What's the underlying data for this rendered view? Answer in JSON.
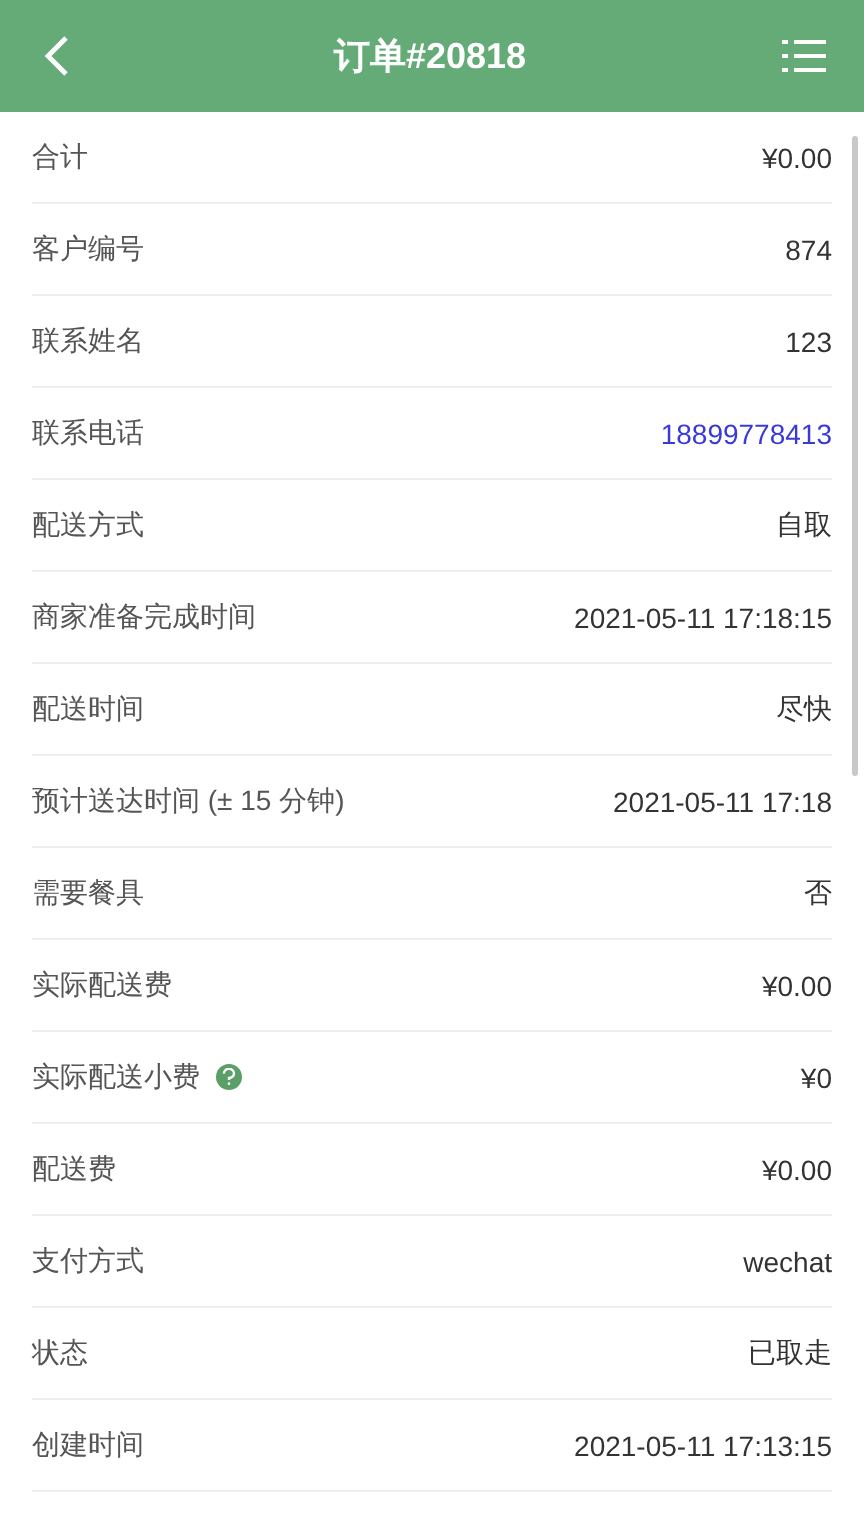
{
  "header": {
    "title": "订单#20818"
  },
  "rows": [
    {
      "label": "合计",
      "value": "¥0.00",
      "kind": "plain",
      "help": false
    },
    {
      "label": "客户编号",
      "value": "874",
      "kind": "plain",
      "help": false
    },
    {
      "label": "联系姓名",
      "value": "123",
      "kind": "plain",
      "help": false
    },
    {
      "label": "联系电话",
      "value": "18899778413",
      "kind": "link",
      "help": false
    },
    {
      "label": "配送方式",
      "value": "自取",
      "kind": "plain",
      "help": false
    },
    {
      "label": "商家准备完成时间",
      "value": "2021-05-11 17:18:15",
      "kind": "plain",
      "help": false
    },
    {
      "label": "配送时间",
      "value": "尽快",
      "kind": "plain",
      "help": false
    },
    {
      "label": "预计送达时间 (± 15 分钟)",
      "value": "2021-05-11 17:18",
      "kind": "plain",
      "help": false
    },
    {
      "label": "需要餐具",
      "value": "否",
      "kind": "plain",
      "help": false
    },
    {
      "label": "实际配送费",
      "value": "¥0.00",
      "kind": "plain",
      "help": false
    },
    {
      "label": "实际配送小费",
      "value": "¥0",
      "kind": "plain",
      "help": true
    },
    {
      "label": "配送费",
      "value": "¥0.00",
      "kind": "plain",
      "help": false
    },
    {
      "label": "支付方式",
      "value": "wechat",
      "kind": "plain",
      "help": false
    },
    {
      "label": "状态",
      "value": "已取走",
      "kind": "plain",
      "help": false
    },
    {
      "label": "创建时间",
      "value": "2021-05-11 17:13:15",
      "kind": "plain",
      "help": false
    }
  ]
}
